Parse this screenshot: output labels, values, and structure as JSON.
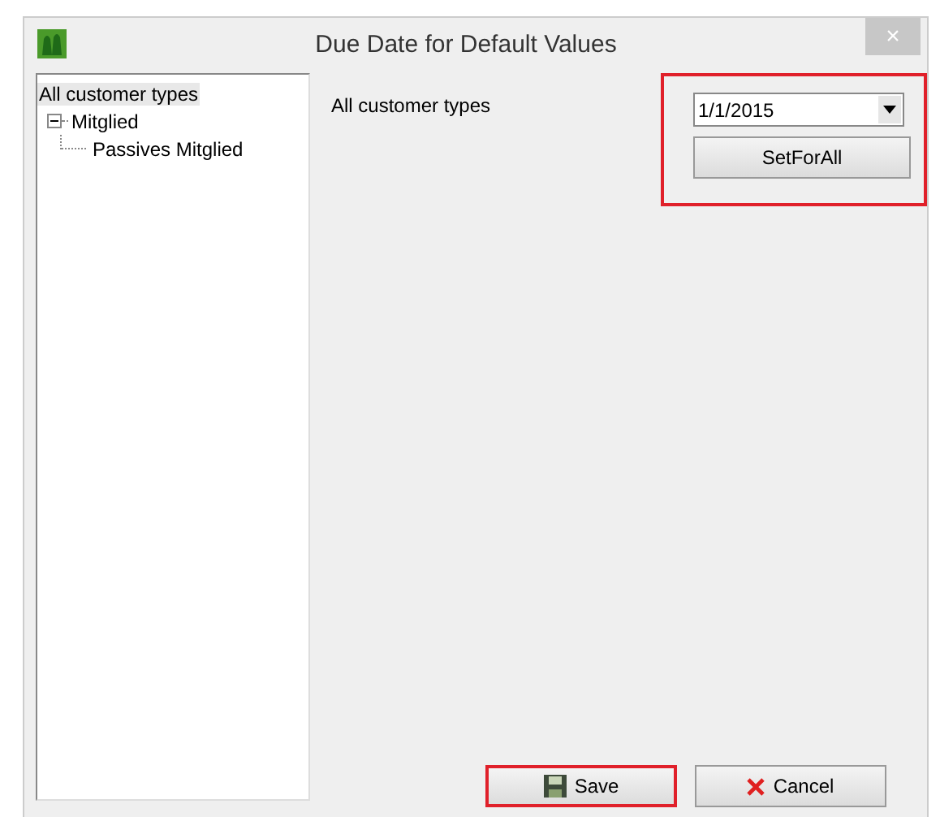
{
  "window": {
    "title": "Due Date for Default Values",
    "close": "×"
  },
  "tree": [
    {
      "label": "All customer types",
      "selected": true,
      "children": [
        {
          "label": "Mitglied",
          "expanded": true,
          "selected": false,
          "children": [
            {
              "label": "Passives Mitglied",
              "selected": false
            }
          ]
        }
      ]
    }
  ],
  "content": {
    "label": "All customer types",
    "date_field": {
      "value": "1/1/2015",
      "highlighted": true
    },
    "set_button": "SetForAll"
  },
  "buttons": [
    {
      "kind": "save",
      "label": "Save",
      "highlighted": true
    },
    {
      "kind": "cancel",
      "label": "Cancel",
      "highlighted": false
    }
  ]
}
